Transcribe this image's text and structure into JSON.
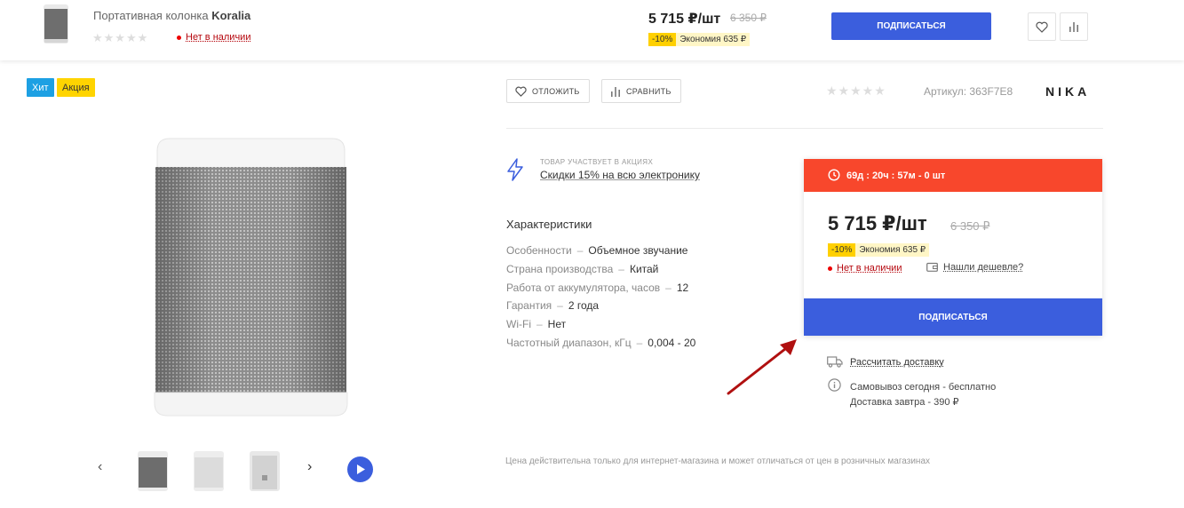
{
  "sticky": {
    "title_prefix": "Портативная колонка",
    "title_brand": "Koralia",
    "stars": "★★★★★",
    "availability": "Нет в наличии",
    "price": "5 715 ₽/шт",
    "old_price": "6 350 ₽",
    "discount_pct": "-10%",
    "discount_save": "Экономия 635 ₽",
    "subscribe_label": "ПОДПИСАТЬСЯ"
  },
  "badges": {
    "hit": "Хит",
    "promo": "Акция"
  },
  "actions": {
    "postpone": "ОТЛОЖИТЬ",
    "compare": "СРАВНИТЬ"
  },
  "product": {
    "stars": "★★★★★",
    "sku_label": "Артикул:",
    "sku_value": "363F7E8",
    "brand": "NIKA"
  },
  "promo": {
    "caption": "ТОВАР УЧАСТВУЕТ В АКЦИЯХ",
    "link": "Скидки 15% на всю электронику"
  },
  "characteristics": {
    "heading": "Характеристики",
    "rows": [
      {
        "key": "Особенности",
        "value": "Объемное звучание"
      },
      {
        "key": "Страна производства",
        "value": "Китай"
      },
      {
        "key": "Работа от аккумулятора, часов",
        "value": "12"
      },
      {
        "key": "Гарантия",
        "value": "2 года"
      },
      {
        "key": "Wi-Fi",
        "value": "Нет"
      },
      {
        "key": "Частотный диапазон, кГц",
        "value": "0,004 - 20"
      }
    ],
    "dash": "–"
  },
  "note": "Цена действительна только для интернет-магазина и может отличаться от цен в розничных магазинах",
  "buybox": {
    "timer": "69д : 20ч : 57м - 0 шт",
    "price": "5 715 ₽/шт",
    "old_price": "6 350 ₽",
    "discount_pct": "-10%",
    "discount_save": "Экономия 635 ₽",
    "availability": "Нет в наличии",
    "cheaper": "Нашли дешевле?",
    "subscribe_label": "ПОДПИСАТЬСЯ"
  },
  "delivery": {
    "calc_link": "Рассчитать доставку",
    "pickup_today": "Самовывоз сегодня - бесплатно",
    "delivery_tomorrow": "Доставка завтра - 390 ₽"
  },
  "colors": {
    "accent": "#3b5edd",
    "timer": "#f8472c",
    "hit": "#1da0e3",
    "promo": "#ffd400",
    "arrow": "#b01010"
  }
}
